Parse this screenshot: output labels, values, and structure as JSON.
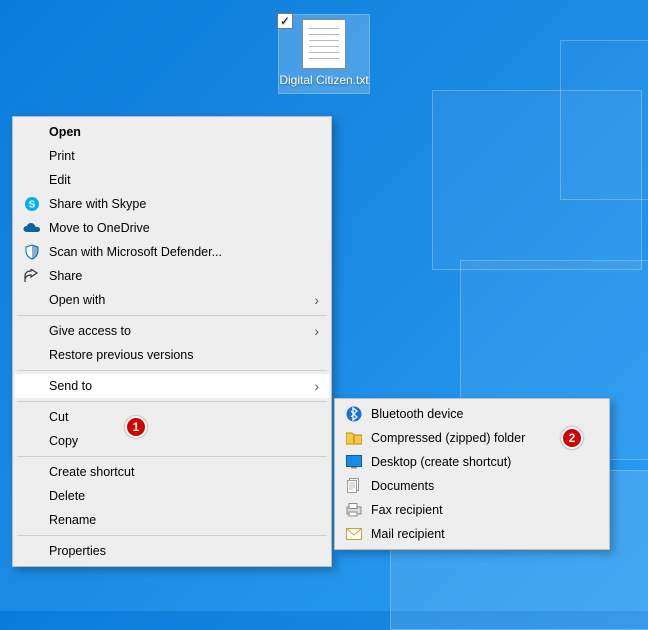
{
  "desktop_file": {
    "name": "Digital Citizen.txt"
  },
  "context_menu": {
    "open": "Open",
    "print": "Print",
    "edit": "Edit",
    "share_skype": "Share with Skype",
    "move_onedrive": "Move to OneDrive",
    "defender": "Scan with Microsoft Defender...",
    "share": "Share",
    "open_with": "Open with",
    "give_access": "Give access to",
    "restore": "Restore previous versions",
    "send_to": "Send to",
    "cut": "Cut",
    "copy": "Copy",
    "create_shortcut": "Create shortcut",
    "delete": "Delete",
    "rename": "Rename",
    "properties": "Properties"
  },
  "send_to_submenu": {
    "bluetooth": "Bluetooth device",
    "zip": "Compressed (zipped) folder",
    "desktop": "Desktop (create shortcut)",
    "documents": "Documents",
    "fax": "Fax recipient",
    "mail": "Mail recipient"
  },
  "annotations": {
    "one": "1",
    "two": "2"
  }
}
